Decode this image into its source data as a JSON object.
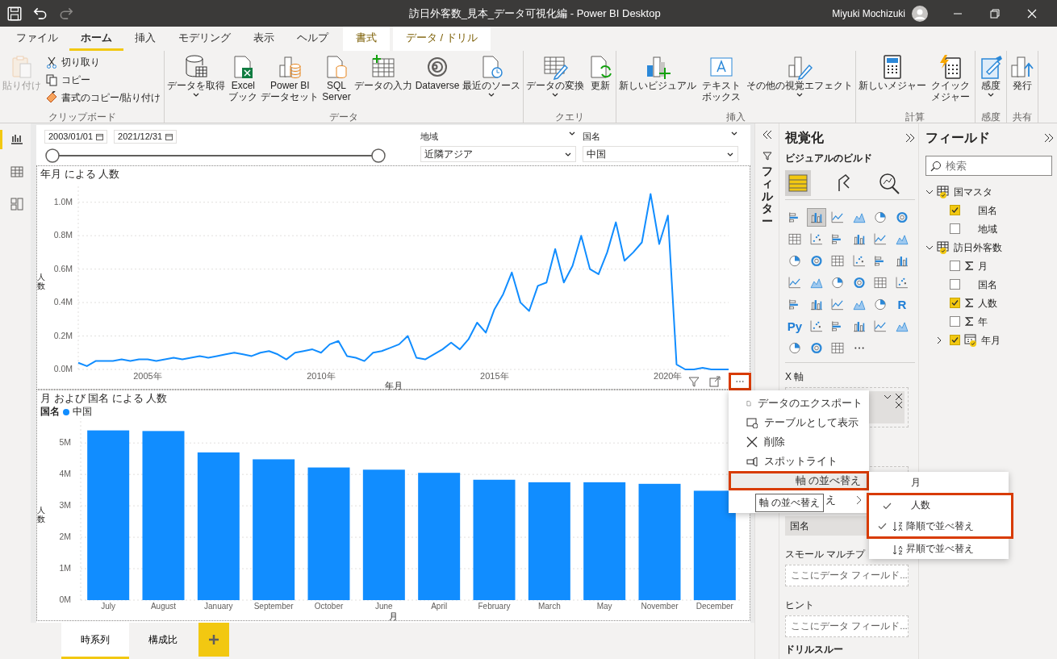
{
  "window": {
    "title": "訪日外客数_見本_データ可視化編 - Power BI Desktop",
    "user": "Miyuki Mochizuki",
    "quick_access": [
      {
        "kind": "save",
        "disabled": false
      },
      {
        "kind": "undo",
        "disabled": false
      },
      {
        "kind": "redo",
        "disabled": true
      }
    ]
  },
  "menu_tabs": [
    {
      "label": "ファイル",
      "selected": false,
      "contextual": false
    },
    {
      "label": "ホーム",
      "selected": true,
      "contextual": false
    },
    {
      "label": "挿入",
      "selected": false,
      "contextual": false
    },
    {
      "label": "モデリング",
      "selected": false,
      "contextual": false
    },
    {
      "label": "表示",
      "selected": false,
      "contextual": false
    },
    {
      "label": "ヘルプ",
      "selected": false,
      "contextual": false
    },
    {
      "label": "書式",
      "selected": false,
      "contextual": true
    },
    {
      "label": "データ / ドリル",
      "selected": false,
      "contextual": true
    }
  ],
  "ribbon": [
    {
      "name": "クリップボード",
      "buttons": [
        {
          "label": "貼り付け",
          "kind": "large",
          "disabled": true,
          "dropdown": false
        },
        {
          "label": "切り取り",
          "kind": "small"
        },
        {
          "label": "コピー",
          "kind": "small"
        },
        {
          "label": "書式のコピー/貼り付け",
          "kind": "small"
        }
      ]
    },
    {
      "name": "データ",
      "buttons": [
        {
          "label": "データを取得",
          "kind": "large",
          "disabled": false,
          "dropdown": true
        },
        {
          "label": "Excel\nブック",
          "kind": "large",
          "disabled": false,
          "dropdown": false
        },
        {
          "label": "Power BI\nデータセット",
          "kind": "large",
          "disabled": false,
          "dropdown": false
        },
        {
          "label": "SQL\nServer",
          "kind": "large",
          "disabled": false,
          "dropdown": false
        },
        {
          "label": "データの入力",
          "kind": "large",
          "disabled": false,
          "dropdown": false
        },
        {
          "label": "Dataverse",
          "kind": "large",
          "disabled": false,
          "dropdown": false
        },
        {
          "label": "最近のソース",
          "kind": "large",
          "disabled": false,
          "dropdown": true
        }
      ]
    },
    {
      "name": "クエリ",
      "buttons": [
        {
          "label": "データの変換",
          "kind": "large",
          "disabled": false,
          "dropdown": true
        },
        {
          "label": "更新",
          "kind": "large",
          "disabled": false,
          "dropdown": false
        }
      ]
    },
    {
      "name": "挿入",
      "buttons": [
        {
          "label": "新しいビジュアル",
          "kind": "large",
          "disabled": false,
          "dropdown": false
        },
        {
          "label": "テキストボックス",
          "kind": "large",
          "disabled": false,
          "dropdown": false,
          "wrap": true
        },
        {
          "label": "その他の視覚エフェクト",
          "kind": "large",
          "disabled": false,
          "dropdown": true
        }
      ]
    },
    {
      "name": "計算",
      "buttons": [
        {
          "label": "新しいメジャー",
          "kind": "large",
          "disabled": false,
          "dropdown": false
        },
        {
          "label": "クイックメジャー",
          "kind": "large",
          "disabled": false,
          "dropdown": false,
          "wrap": true
        }
      ]
    },
    {
      "name": "感度",
      "buttons": [
        {
          "label": "感度",
          "kind": "large",
          "disabled": false,
          "dropdown": true
        }
      ]
    },
    {
      "name": "共有",
      "buttons": [
        {
          "label": "発行",
          "kind": "large",
          "disabled": false,
          "dropdown": false
        }
      ]
    }
  ],
  "left_rail": [
    {
      "kind": "report",
      "selected": true
    },
    {
      "kind": "data",
      "selected": false
    },
    {
      "kind": "model",
      "selected": false
    }
  ],
  "slicers": {
    "date_from": "2003/01/01",
    "date_to": "2021/12/31",
    "range_thumbs": [
      {
        "level": 0
      },
      {
        "level": 1
      }
    ],
    "dropdowns": [
      {
        "label": "地域",
        "value": "近隣アジア"
      },
      {
        "label": "国名",
        "value": "中国"
      }
    ]
  },
  "line_visual": {
    "more_outlined": true,
    "chart_data": {
      "type": "line",
      "title": "年月 による 人数",
      "xlabel": "年月",
      "ylabel": "人数",
      "grid": true,
      "xlim": [
        2003,
        2021.75
      ],
      "ylim": [
        0,
        1.1
      ],
      "x": [
        2003,
        2003.25,
        2003.5,
        2003.75,
        2004,
        2004.25,
        2004.5,
        2004.75,
        2005,
        2005.25,
        2005.5,
        2005.75,
        2006,
        2006.25,
        2006.5,
        2006.75,
        2007,
        2007.25,
        2007.5,
        2007.75,
        2008,
        2008.25,
        2008.5,
        2008.75,
        2009,
        2009.25,
        2009.5,
        2009.75,
        2010,
        2010.25,
        2010.5,
        2010.75,
        2011,
        2011.25,
        2011.5,
        2011.75,
        2012,
        2012.25,
        2012.5,
        2012.75,
        2013,
        2013.25,
        2013.5,
        2013.75,
        2014,
        2014.25,
        2014.5,
        2014.75,
        2015,
        2015.25,
        2015.5,
        2015.75,
        2016,
        2016.25,
        2016.5,
        2016.75,
        2017,
        2017.25,
        2017.5,
        2017.75,
        2018,
        2018.25,
        2018.5,
        2018.75,
        2019,
        2019.25,
        2019.5,
        2019.75,
        2020,
        2020.25,
        2020.5,
        2020.75,
        2021,
        2021.25,
        2021.5,
        2021.75
      ],
      "series": [
        {
          "color": "#118dff",
          "values": [
            0.04,
            0.02,
            0.05,
            0.05,
            0.05,
            0.06,
            0.05,
            0.06,
            0.06,
            0.05,
            0.06,
            0.07,
            0.06,
            0.07,
            0.08,
            0.07,
            0.08,
            0.09,
            0.1,
            0.09,
            0.08,
            0.1,
            0.11,
            0.09,
            0.06,
            0.1,
            0.11,
            0.12,
            0.1,
            0.15,
            0.17,
            0.08,
            0.07,
            0.05,
            0.1,
            0.11,
            0.13,
            0.15,
            0.2,
            0.07,
            0.06,
            0.09,
            0.12,
            0.16,
            0.12,
            0.18,
            0.28,
            0.22,
            0.36,
            0.45,
            0.58,
            0.4,
            0.35,
            0.5,
            0.52,
            0.72,
            0.52,
            0.62,
            0.8,
            0.6,
            0.57,
            0.7,
            0.88,
            0.65,
            0.7,
            0.76,
            1.05,
            0.75,
            0.92,
            0.03,
            0,
            0,
            0.01,
            0,
            0,
            0
          ]
        }
      ],
      "xticks": [
        {
          "value": 2005,
          "label": "2005年"
        },
        {
          "value": 2010,
          "label": "2010年"
        },
        {
          "value": 2015,
          "label": "2015年"
        },
        {
          "value": 2020,
          "label": "2020年"
        }
      ],
      "yticks": [
        {
          "value": 0,
          "label": "0.0M"
        },
        {
          "value": 0.2,
          "label": "0.2M"
        },
        {
          "value": 0.4,
          "label": "0.4M"
        },
        {
          "value": 0.6,
          "label": "0.6M"
        },
        {
          "value": 0.8,
          "label": "0.8M"
        },
        {
          "value": 1.0,
          "label": "1.0M"
        }
      ]
    }
  },
  "bar_visual": {
    "legend_title": "国名",
    "chart_data": {
      "type": "bar",
      "title": "月 および 国名 による 人数",
      "xlabel": "月",
      "ylabel": "人数",
      "grid": true,
      "ylim": [
        0,
        5.8
      ],
      "categories": [
        "July",
        "August",
        "January",
        "September",
        "October",
        "June",
        "April",
        "February",
        "March",
        "May",
        "November",
        "December"
      ],
      "series": [
        {
          "name": "中国",
          "color": "#118dff",
          "values": [
            5.4,
            5.38,
            4.7,
            4.48,
            4.22,
            4.15,
            4.05,
            3.83,
            3.75,
            3.75,
            3.7,
            3.48
          ]
        }
      ],
      "yticks": [
        {
          "value": 0,
          "label": "0M"
        },
        {
          "value": 1,
          "label": "1M"
        },
        {
          "value": 2,
          "label": "2M"
        },
        {
          "value": 3,
          "label": "3M"
        },
        {
          "value": 4,
          "label": "4M"
        },
        {
          "value": 5,
          "label": "5M"
        }
      ]
    }
  },
  "context_menu": [
    {
      "label": "データのエクスポート",
      "kind": "export",
      "outlined": false
    },
    {
      "label": "テーブルとして表示",
      "kind": "table",
      "outlined": false
    },
    {
      "label": "削除",
      "kind": "delete",
      "outlined": false
    },
    {
      "label": "スポットライト",
      "kind": "spotlight",
      "outlined": false
    },
    {
      "label": "軸 の並べ替え",
      "kind": "submenu",
      "outlined": true
    },
    {
      "label": "え",
      "kind": "submenu",
      "outlined": false
    }
  ],
  "tooltip": "軸 の並べ替え",
  "submenu": [
    {
      "label": "月",
      "kind": "field",
      "checked": false,
      "outlined": false
    },
    {
      "label": "人数",
      "kind": "field",
      "checked": true,
      "outlined": true
    },
    {
      "label": "降順で並べ替え",
      "kind": "descending",
      "checked": true,
      "outlined": true
    },
    {
      "label": "昇順で並べ替え",
      "kind": "ascending",
      "checked": false,
      "outlined": false
    }
  ],
  "page_tabs": [
    {
      "label": "時系列",
      "selected": true
    },
    {
      "label": "構成比",
      "selected": false
    }
  ],
  "filters": {
    "label": "フィルター"
  },
  "visualizations": {
    "title": "視覚化",
    "subtitle": "ビジュアルのビルド",
    "build_tabs": [
      {
        "selected": true
      },
      {
        "selected": false
      },
      {
        "selected": false
      }
    ],
    "gallery": [
      {
        "kind": "icon",
        "selected": false
      },
      {
        "kind": "icon",
        "selected": true
      },
      {
        "kind": "icon",
        "selected": false
      },
      {
        "kind": "icon",
        "selected": false
      },
      {
        "kind": "icon",
        "selected": false
      },
      {
        "kind": "icon",
        "selected": false
      },
      {
        "kind": "icon",
        "selected": false
      },
      {
        "kind": "icon",
        "selected": false
      },
      {
        "kind": "icon",
        "selected": false
      },
      {
        "kind": "icon",
        "selected": false
      },
      {
        "kind": "icon",
        "selected": false
      },
      {
        "kind": "icon",
        "selected": false
      },
      {
        "kind": "icon",
        "selected": false
      },
      {
        "kind": "icon",
        "selected": false
      },
      {
        "kind": "icon",
        "selected": false
      },
      {
        "kind": "icon",
        "selected": false
      },
      {
        "kind": "icon",
        "selected": false
      },
      {
        "kind": "icon",
        "selected": false
      },
      {
        "kind": "icon",
        "selected": false
      },
      {
        "kind": "icon",
        "selected": false
      },
      {
        "kind": "icon",
        "selected": false
      },
      {
        "kind": "icon",
        "selected": false
      },
      {
        "kind": "icon",
        "selected": false
      },
      {
        "kind": "icon",
        "selected": false
      },
      {
        "kind": "icon",
        "selected": false
      },
      {
        "kind": "icon",
        "selected": false
      },
      {
        "kind": "icon",
        "selected": false
      },
      {
        "kind": "icon",
        "selected": false
      },
      {
        "kind": "icon",
        "selected": false
      },
      {
        "kind": "text",
        "label": "R",
        "selected": false
      },
      {
        "kind": "text",
        "label": "Py",
        "selected": false
      },
      {
        "kind": "icon",
        "selected": false
      },
      {
        "kind": "icon",
        "selected": false
      },
      {
        "kind": "icon",
        "selected": false
      },
      {
        "kind": "icon",
        "selected": false
      },
      {
        "kind": "icon",
        "selected": false
      },
      {
        "kind": "icon",
        "selected": false
      },
      {
        "kind": "icon",
        "selected": false
      },
      {
        "kind": "icon",
        "selected": false
      },
      {
        "kind": "more",
        "selected": false
      }
    ],
    "wells": [
      {
        "kind": "covered",
        "label": "X 軸"
      },
      {
        "kind": "covered-box"
      },
      {
        "kind": "chip",
        "chip": "国名"
      },
      {
        "kind": "drop",
        "label": "スモール マルチプ",
        "placeholder": "ここにデータ フィールド..."
      },
      {
        "kind": "drop",
        "label": "ヒント",
        "placeholder": "ここにデータ フィールド..."
      },
      {
        "kind": "heading",
        "label": "ドリルスルー"
      }
    ]
  },
  "fields": {
    "title": "フィールド",
    "search_placeholder": "検索",
    "tables": [
      {
        "name": "国マスタ",
        "expanded": true,
        "children": [
          {
            "name": "国名",
            "kind": "text",
            "checked": true
          },
          {
            "name": "地域",
            "kind": "text",
            "checked": false
          }
        ]
      },
      {
        "name": "訪日外客数",
        "expanded": true,
        "children": [
          {
            "name": "月",
            "kind": "sum",
            "checked": false
          },
          {
            "name": "国名",
            "kind": "text",
            "checked": false
          },
          {
            "name": "人数",
            "kind": "sum",
            "checked": true
          },
          {
            "name": "年",
            "kind": "sum",
            "checked": false
          },
          {
            "name": "年月",
            "kind": "date",
            "checked": true,
            "expanded": false
          }
        ]
      }
    ]
  }
}
